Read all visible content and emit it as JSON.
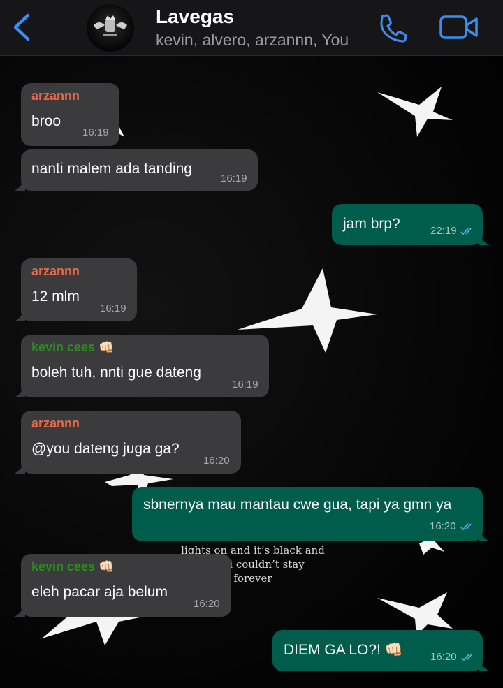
{
  "header": {
    "title": "Lavegas",
    "members": "kevin, alvero, arzannn, You"
  },
  "colors": {
    "arzannn": "#e86a4a",
    "kevin": "#2e8b1e",
    "incoming_bubble": "#3b3b3d",
    "outgoing_bubble": "#005c4b",
    "accent": "#3a8ef0",
    "read_ticks": "#53bdeb"
  },
  "wallpaper": {
    "line1": "lights on and it’s black and",
    "line2": "i couldn’t stay",
    "line3": "forever"
  },
  "messages": [
    {
      "direction": "in",
      "sender": "arzannn",
      "text": "broo",
      "time": "16:19"
    },
    {
      "direction": "in",
      "text": "nanti malem ada tanding",
      "time": "16:19"
    },
    {
      "direction": "out",
      "text": "jam brp?",
      "time": "22:19",
      "status": "read"
    },
    {
      "direction": "in",
      "sender": "arzannn",
      "text": "12 mlm",
      "time": "16:19"
    },
    {
      "direction": "in",
      "sender": "kevin cees 👊🏻",
      "text": "boleh tuh, nnti gue dateng",
      "time": "16:19"
    },
    {
      "direction": "in",
      "sender": "arzannn",
      "text": "@you dateng juga ga?",
      "time": "16:20"
    },
    {
      "direction": "out",
      "text": "sbnernya mau mantau cwe gua, tapi ya gmn ya",
      "time": "16:20",
      "status": "read"
    },
    {
      "direction": "in",
      "sender": "kevin cees 👊🏻",
      "text": "eleh pacar aja belum",
      "time": "16:20"
    },
    {
      "direction": "out",
      "text": "DIEM GA LO?! 👊🏻",
      "time": "16:20",
      "status": "read"
    }
  ]
}
